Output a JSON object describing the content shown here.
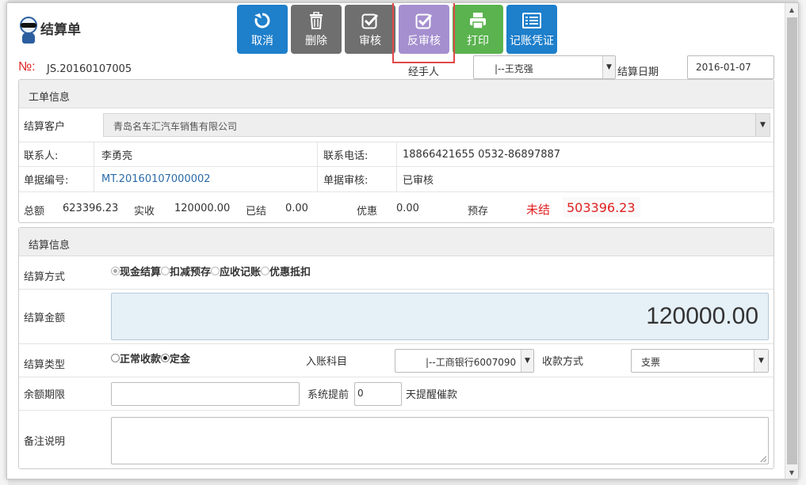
{
  "dialog": {
    "title": "结算单",
    "toolbar": [
      {
        "label": "取消",
        "icon": "refresh-icon",
        "color": "#1e7fcb"
      },
      {
        "label": "删除",
        "icon": "trash-icon",
        "color": "#6f6f6f"
      },
      {
        "label": "审核",
        "icon": "check-square-icon",
        "color": "#6f6f6f"
      },
      {
        "label": "反审核",
        "icon": "check-square-icon",
        "color": "#a58fcf"
      },
      {
        "label": "打印",
        "icon": "printer-icon",
        "color": "#5ab34f"
      },
      {
        "label": "记账凭证",
        "icon": "list-icon",
        "color": "#1e7fcb"
      }
    ]
  },
  "header": {
    "no_label": "№:",
    "no_value": "JS.20160107005",
    "handler_label": "经手人",
    "handler_value": "|--王克强",
    "date_label": "结算日期",
    "date_value": "2016-01-07"
  },
  "work_order": {
    "title": "工单信息",
    "customer_label": "结算客户",
    "customer_value": "青岛名车汇汽车销售有限公司",
    "contact_label": "联系人:",
    "contact_value": "李勇亮",
    "phone_label": "联系电话:",
    "phone_value": "18866421655 0532-86897887",
    "doc_no_label": "单据编号:",
    "doc_no_value": "MT.20160107000002",
    "doc_audit_label": "单据审核:",
    "doc_audit_value": "已审核",
    "summary": {
      "total_label": "总额",
      "total_value": "623396.23",
      "received_label": "实收",
      "received_value": "120000.00",
      "settled_label": "已结",
      "settled_value": "0.00",
      "discount_label": "优惠",
      "discount_value": "0.00",
      "prepaid_label": "预存",
      "unsettled_label": "未结",
      "unsettled_value": "503396.23",
      "unsettled_color": "#e02020"
    }
  },
  "settlement": {
    "title": "结算信息",
    "method_label": "结算方式",
    "methods": [
      "现金结算",
      "扣减预存",
      "应收记账",
      "优惠抵扣"
    ],
    "method_selected": "现金结算",
    "amount_label": "结算金额",
    "amount_value": "120000.00",
    "type_label": "结算类型",
    "types": [
      "正常收款",
      "定金"
    ],
    "type_selected": "定金",
    "account_label": "入账科目",
    "account_value": "|--工商银行6007090",
    "pay_method_label": "收款方式",
    "pay_method_value": "支票",
    "balance_term_label": "余额期限",
    "balance_term_value": "",
    "remind_label_pre": "系统提前",
    "remind_days": "0",
    "remind_label_post": "天提醒催款",
    "note_label": "备注说明",
    "note_value": ""
  }
}
